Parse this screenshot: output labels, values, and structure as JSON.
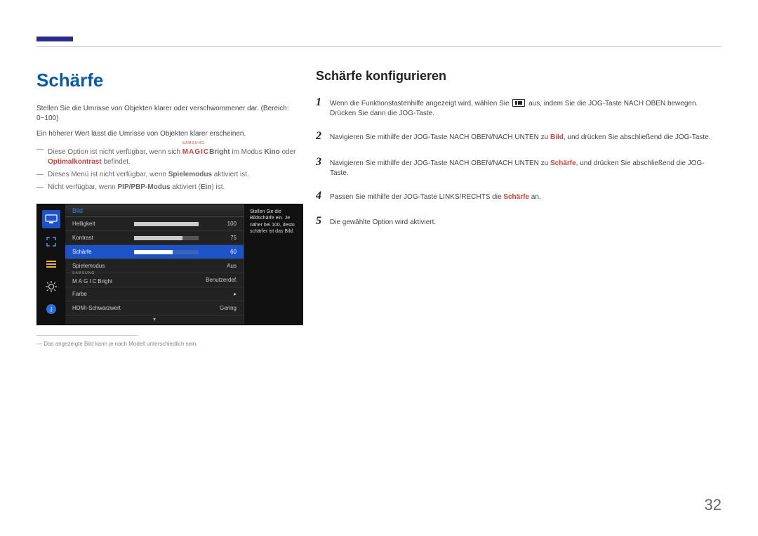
{
  "left": {
    "title": "Schärfe",
    "p1": "Stellen Sie die Umrisse von Objekten klarer oder verschwommener dar. (Bereich: 0~100)",
    "p2": "Ein höherer Wert lässt die Umrisse von Objekten klarer erscheinen.",
    "note1_a": "Diese Option ist nicht verfügbar, wenn sich ",
    "note1_magic_small": "SAMSUNG",
    "note1_magic": "MAGIC",
    "note1_bright": "Bright",
    "note1_b": " im Modus ",
    "note1_kino": "Kino",
    "note1_c": " oder ",
    "note1_opt": "Optimalkontrast",
    "note1_d": " befindet.",
    "note2_a": "Dieses Menü ist nicht verfügbar, wenn ",
    "note2_spiel": "Spielemodus",
    "note2_b": " aktiviert ist.",
    "note3_a": "Nicht verfügbar, wenn ",
    "note3_pip": "PIP/PBP-Modus",
    "note3_b": " aktiviert (",
    "note3_ein": "Ein",
    "note3_c": ") ist.",
    "osd": {
      "header": "Bild",
      "rows": {
        "helligkeit": {
          "label": "Helligkeit",
          "value": "100"
        },
        "kontrast": {
          "label": "Kontrast",
          "value": "75"
        },
        "schaerfe": {
          "label": "Schärfe",
          "value": "60"
        },
        "spielemodus": {
          "label": "Spielemodus",
          "value": "Aus"
        },
        "bright_small": "SAMSUNG",
        "bright_magic": "MAGIC",
        "bright_suffix": "Bright",
        "bright_value": "Benutzerdef.",
        "farbe": {
          "label": "Farbe",
          "arrow": "▸"
        },
        "hdmi": {
          "label": "HDMI-Schwarzwert",
          "value": "Gering"
        }
      },
      "help": "Stellen Sie die Bildschärfe ein. Je näher bei 100, desto schärfer ist das Bild.",
      "scrolldown": "▾"
    },
    "footnote_dash": "―",
    "footnote": "Das angezeigte Bild kann je nach Modell unterschiedlich sein."
  },
  "right": {
    "title": "Schärfe konfigurieren",
    "step1a": "Wenn die Funktionstastenhilfe angezeigt wird, wählen Sie ",
    "step1b": " aus, indem Sie die JOG-Taste NACH OBEN bewegen. Drücken Sie dann die JOG-Taste.",
    "step2a": "Navigieren Sie mithilfe der JOG-Taste NACH OBEN/NACH UNTEN zu ",
    "step2b": ", und drücken Sie abschließend die JOG-Taste.",
    "step2_bild": "Bild",
    "step3a": "Navigieren Sie mithilfe der JOG-Taste NACH OBEN/NACH UNTEN zu ",
    "step3b": ", und drücken Sie abschließend die JOG-Taste.",
    "step3_scharfe": "Schärfe",
    "step4a": "Passen Sie mithilfe der JOG-Taste LINKS/RECHTS die ",
    "step4b": " an.",
    "step4_scharfe": "Schärfe",
    "step5": "Die gewählte Option wird aktiviert.",
    "nums": {
      "n1": "1",
      "n2": "2",
      "n3": "3",
      "n4": "4",
      "n5": "5"
    }
  },
  "page_number": "32"
}
